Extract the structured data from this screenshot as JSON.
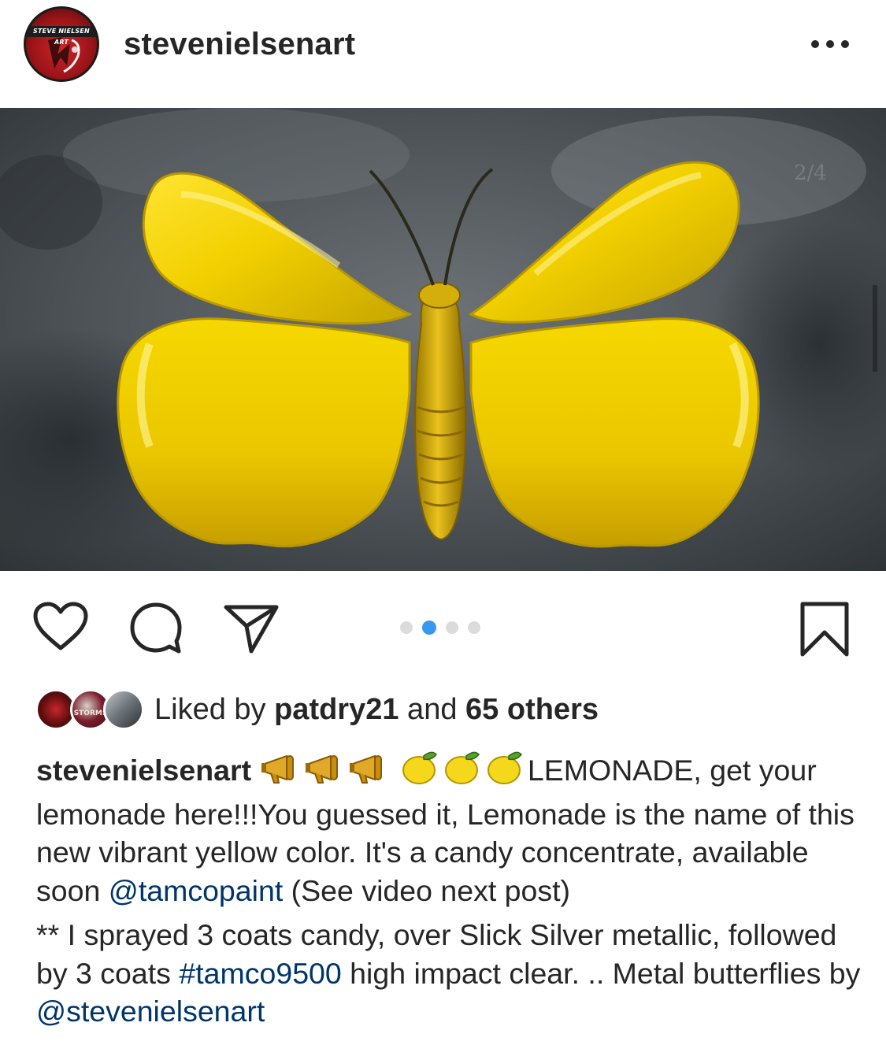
{
  "post": {
    "username": "stevenielsenart",
    "avatar_banner_text": "STEVE NIELSEN ART",
    "more_icon": "more-horizontal-icon",
    "photo_counter": "2/4"
  },
  "carousel": {
    "count": 4,
    "active_index": 1
  },
  "actions": {
    "like_icon": "heart-icon",
    "comment_icon": "comment-icon",
    "share_icon": "send-icon",
    "save_icon": "bookmark-icon"
  },
  "likes": {
    "prefix": "Liked by ",
    "user": "patdry21",
    "middle": " and ",
    "others": "65 others",
    "liker_avatar_text": "STORMS"
  },
  "caption": {
    "username": "stevenielsenart",
    "emojis": [
      "megaphone",
      "megaphone",
      "megaphone",
      "lemon",
      "lemon",
      "lemon"
    ],
    "text_1": "LEMONADE, get your lemonade here!!!You guessed it, Lemonade is the name of this new vibrant yellow color. It's a candy concentrate, available soon ",
    "mention_1": "@tamcopaint",
    "text_2": " (See video next post)",
    "text_3": "** I sprayed 3 coats candy, over Slick Silver metallic, followed by 3 coats ",
    "hashtag_1": "#tamco9500",
    "text_4": " high impact clear. .. Metal butterflies by ",
    "mention_2": "@stevenielsenart"
  },
  "colors": {
    "text": "#262626",
    "link": "#003569",
    "dot_active": "#3897f0",
    "dot_inactive": "#dbdbdb",
    "butterfly_yellow": "#f2d000"
  }
}
